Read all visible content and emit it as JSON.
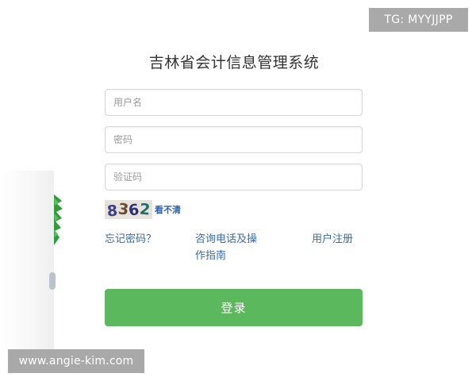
{
  "page": {
    "title": "吉林省会计信息管理系统"
  },
  "form": {
    "username_placeholder": "用户名",
    "password_placeholder": "密码",
    "captcha_placeholder": "验证码",
    "captcha_code": "8362",
    "captcha_refresh_label": "看不清",
    "submit_label": "登录"
  },
  "links": {
    "forgot_password": "忘记密码？",
    "consult_help": "咨询电话及操作指南",
    "register": "用户注册"
  },
  "watermarks": {
    "top_right": "TG: MYYJJPP",
    "bottom_left": "www.angie-kim.com"
  },
  "colors": {
    "primary_button": "#5cb85c",
    "link": "#3a6aa8",
    "captcha_refresh": "#2d62b0"
  }
}
